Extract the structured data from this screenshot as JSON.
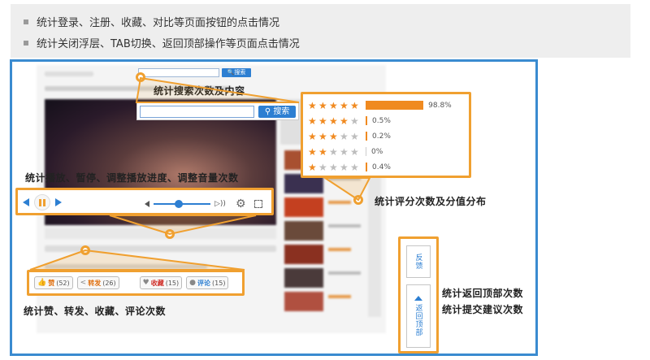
{
  "bullets": [
    "统计登录、注册、收藏、对比等页面按钮的点击情况",
    "统计关闭浮层、TAB切换、返回顶部操作等页面点击情况"
  ],
  "search": {
    "button_label": "搜索",
    "mini_button_label": "搜索",
    "annotation": "统计搜索次数及内容"
  },
  "player": {
    "annotation": "统计播放、暂停、调整播放进度、调整音量次数"
  },
  "rating": {
    "annotation": "统计评分次数及分值分布",
    "rows": [
      {
        "stars": 5,
        "percent": 98.8,
        "label": "98.8%"
      },
      {
        "stars": 4,
        "percent": 0.5,
        "label": "0.5%"
      },
      {
        "stars": 3,
        "percent": 0.2,
        "label": "0.2%"
      },
      {
        "stars": 2,
        "percent": 0,
        "label": "0%"
      },
      {
        "stars": 1,
        "percent": 0.4,
        "label": "0.4%"
      }
    ],
    "bar_color": "#f08a20"
  },
  "social": {
    "annotation": "统计赞、转发、收藏、评论次数",
    "items": [
      {
        "icon": "thumb-up-icon",
        "name": "赞",
        "count": "52"
      },
      {
        "icon": "share-icon",
        "name": "转发",
        "count": "26"
      },
      {
        "icon": "heart-icon",
        "name": "收藏",
        "count": "15"
      },
      {
        "icon": "comment-icon",
        "name": "评论",
        "count": "15"
      }
    ]
  },
  "side": {
    "feedback_label": "反馈",
    "back_top_label": "返回顶部",
    "annotation_1": "统计返回顶部次数",
    "annotation_2": "统计提交建议次数"
  },
  "colors": {
    "frame": "#3a8bd0",
    "accent": "#f0a030",
    "brand": "#2d7fd2"
  }
}
